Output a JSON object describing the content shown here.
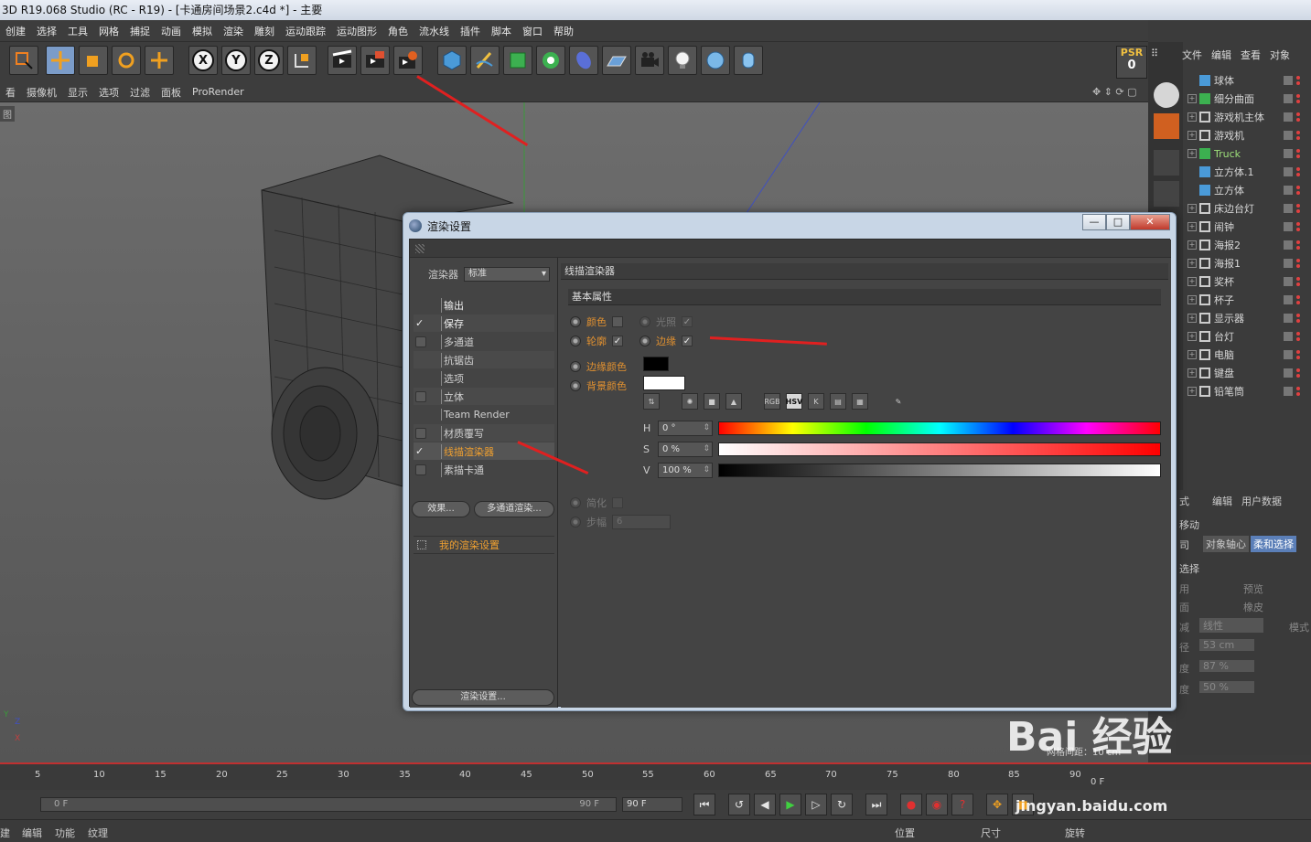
{
  "window": {
    "title": "3D R19.068 Studio (RC - R19) - [卡通房间场景2.c4d *] - 主要"
  },
  "menubar": [
    "创建",
    "选择",
    "工具",
    "网格",
    "捕捉",
    "动画",
    "模拟",
    "渲染",
    "雕刻",
    "运动跟踪",
    "运动图形",
    "角色",
    "流水线",
    "插件",
    "脚本",
    "窗口",
    "帮助"
  ],
  "toolbar": {
    "x": "X",
    "y": "Y",
    "z": "Z",
    "psr_label": "PSR",
    "psr_value": "0"
  },
  "viewport_menu": [
    "看",
    "摄像机",
    "显示",
    "选项",
    "过滤",
    "面板",
    "ProRender"
  ],
  "viewport": {
    "label": "图"
  },
  "object_manager": {
    "menu": [
      "文件",
      "编辑",
      "查看",
      "对象"
    ],
    "objects": [
      "球体",
      "细分曲面",
      "游戏机主体",
      "游戏机",
      "Truck",
      "立方体.1",
      "立方体",
      "床边台灯",
      "闹钟",
      "海报2",
      "海报1",
      "奖杯",
      "杯子",
      "显示器",
      "台灯",
      "电脑",
      "键盘",
      "铅笔筒"
    ]
  },
  "attributes": {
    "menu": [
      "式",
      "编辑",
      "用户数据"
    ],
    "move": "移动",
    "tabs": [
      "司",
      "对象轴心",
      "柔和选择"
    ],
    "select": "选择",
    "rows": [
      {
        "label": "用",
        "label2": "预览"
      },
      {
        "label": "面",
        "label2": "橡皮"
      },
      {
        "label": "减",
        "value": "线性",
        "label3": "模式"
      },
      {
        "label": "径",
        "value": "53 cm"
      },
      {
        "label": "度",
        "value": "87 %"
      },
      {
        "label": "度",
        "value": "50 %"
      }
    ]
  },
  "dialog": {
    "title": "渲染设置",
    "minimize": "—",
    "restore": "□",
    "close": "✕",
    "renderer_label": "渲染器",
    "renderer_value": "标准",
    "nav": [
      {
        "label": "输出",
        "check": "",
        "box": false
      },
      {
        "label": "保存",
        "check": "✓",
        "box": false
      },
      {
        "label": "多通道",
        "check": "",
        "box": true
      },
      {
        "label": "抗锯齿",
        "check": "",
        "box": false
      },
      {
        "label": "选项",
        "check": "",
        "box": false
      },
      {
        "label": "立体",
        "check": "",
        "box": true
      },
      {
        "label": "Team Render",
        "check": "",
        "box": false
      },
      {
        "label": "材质覆写",
        "check": "",
        "box": true
      },
      {
        "label": "线描渲染器",
        "check": "✓",
        "box": false
      },
      {
        "label": "素描卡通",
        "check": "",
        "box": true
      }
    ],
    "effects_button": "效果...",
    "multipass_button": "多通道渲染...",
    "preset_name": "我的渲染设置",
    "render_settings_button": "渲染设置...",
    "section_title": "线描渲染器",
    "sub_title": "基本属性",
    "props": {
      "color": "颜色",
      "color_checked": "",
      "illumination": "光照",
      "illumination_checked": "✓",
      "outline": "轮廓",
      "outline_checked": "✓",
      "edges": "边缘",
      "edges_checked": "✓",
      "edge_color": "边缘颜色",
      "bg_color": "背景颜色",
      "simplify": "简化",
      "simplify_checked": "",
      "step": "步幅",
      "step_value": "6"
    },
    "colors": {
      "edge_color": "#000000",
      "bg_color": "#ffffff"
    },
    "color_modes": [
      "RGB",
      "HSV",
      "K"
    ],
    "hsv": {
      "h_label": "H",
      "h_value": "0 °",
      "s_label": "S",
      "s_value": "0 %",
      "v_label": "V",
      "v_value": "100 %"
    }
  },
  "timeline": {
    "ticks": [
      "5",
      "10",
      "15",
      "20",
      "25",
      "30",
      "35",
      "40",
      "45",
      "50",
      "55",
      "60",
      "65",
      "70",
      "75",
      "80",
      "85",
      "90"
    ],
    "current_frame": "0 F",
    "end_frame_slider": "90 F",
    "end_frame": "90 F",
    "side_frame": "0 F"
  },
  "bottom": {
    "left": [
      "建",
      "编辑",
      "功能",
      "纹理"
    ],
    "coords": [
      "位置",
      "尺寸",
      "旋转"
    ]
  },
  "overlay": {
    "grid_spacing": "网格间距：10 cm"
  },
  "watermark": {
    "text": "Bai 经验",
    "url": "jingyan.baidu.com"
  }
}
